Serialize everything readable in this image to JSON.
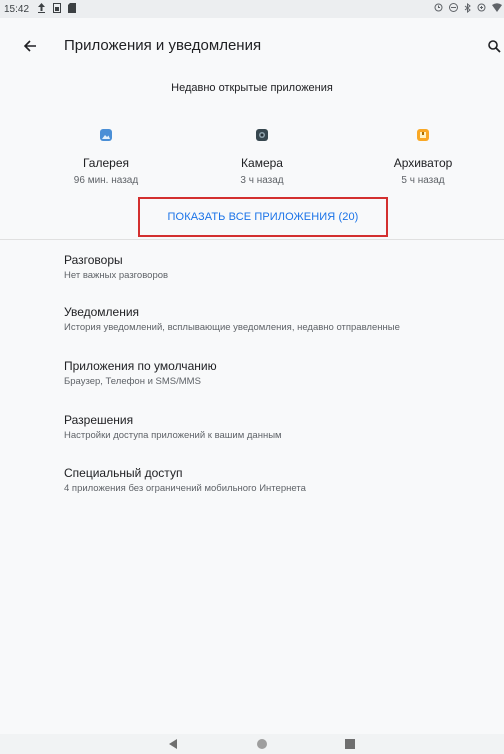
{
  "status_bar": {
    "time": "15:42",
    "left_icons": [
      "upload-icon",
      "sim-icon",
      "sd-card-icon"
    ],
    "right_icons": [
      "alarm-icon",
      "dnd-icon",
      "bluetooth-icon",
      "data-saver-icon",
      "wifi-icon"
    ]
  },
  "toolbar": {
    "title": "Приложения и уведомления"
  },
  "recent": {
    "header": "Недавно открытые приложения",
    "apps": [
      {
        "name": "Галерея",
        "time": "96 мин. назад",
        "icon": "gallery-icon",
        "color": "#4a8fd6"
      },
      {
        "name": "Камера",
        "time": "3 ч назад",
        "icon": "camera-icon",
        "color": "#37474f"
      },
      {
        "name": "Архиватор",
        "time": "5 ч назад",
        "icon": "archiver-icon",
        "color": "#f9a825"
      }
    ],
    "show_all": "ПОКАЗАТЬ ВСЕ ПРИЛОЖЕНИЯ (20)"
  },
  "preferences": [
    {
      "title": "Разговоры",
      "summary": "Нет важных разговоров"
    },
    {
      "title": "Уведомления",
      "summary": "История уведомлений, всплывающие уведомления, недавно отправленные"
    },
    {
      "title": "Приложения по умолчанию",
      "summary": "Браузер, Телефон и SMS/MMS"
    },
    {
      "title": "Разрешения",
      "summary": "Настройки доступа приложений к вашим данным"
    },
    {
      "title": "Специальный доступ",
      "summary": "4 приложения без ограничений мобильного Интернета"
    }
  ],
  "colors": {
    "accent": "#1a73e8",
    "highlight_border": "#d32f2f"
  }
}
